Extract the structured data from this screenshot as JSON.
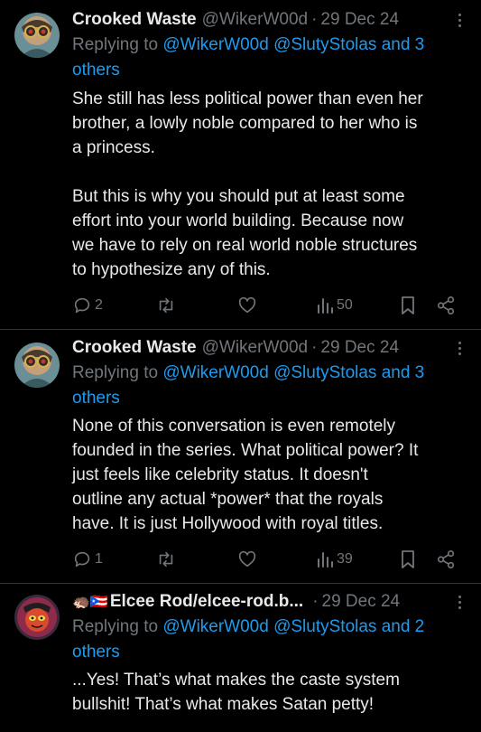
{
  "tweets": [
    {
      "name": "Crooked Waste",
      "handle": "@WikerW00d",
      "sep": "·",
      "date": "29 Dec 24",
      "reply_prefix": "Replying to ",
      "reply_mentions": "@WikerW00d @SlutyStolas and 3",
      "reply_others": "others",
      "body": "She still has less political power than even her\nbrother, a lowly noble compared to her who is\na princess.\n\nBut this is why you should put at least some\neffort into your world building. Because now\nwe have to rely on real world noble structures\nto hypothesize any of this.",
      "replies": "2",
      "views": "50"
    },
    {
      "name": "Crooked Waste",
      "handle": "@WikerW00d",
      "sep": "·",
      "date": "29 Dec 24",
      "reply_prefix": "Replying to ",
      "reply_mentions": "@WikerW00d @SlutyStolas and 3",
      "reply_others": "others",
      "body": "None of this conversation is even remotely\nfounded in the series. What political power? It\njust feels like celebrity status. It doesn't\noutline any actual *power* that the royals\nhave. It is just Hollywood with royal titles.",
      "replies": "1",
      "views": "39"
    },
    {
      "name_emojis": "🦔🇵🇷",
      "name": "Elcee Rod/elcee-rod.b...",
      "sep": "·",
      "date": "29 Dec 24",
      "reply_prefix": "Replying to ",
      "reply_mentions": "@WikerW00d @SlutyStolas and 2",
      "reply_others": "others",
      "body": "...Yes! That’s what makes the caste system\nbullshit! That’s what makes Satan petty!"
    }
  ],
  "colors": {
    "background": "#000000",
    "text": "#e7e9ea",
    "muted": "#71767b",
    "link": "#1d9bf0",
    "divider": "#2f3336"
  },
  "icons": [
    "reply-icon",
    "retweet-icon",
    "like-icon",
    "views-icon",
    "bookmark-icon",
    "share-icon",
    "more-icon"
  ]
}
